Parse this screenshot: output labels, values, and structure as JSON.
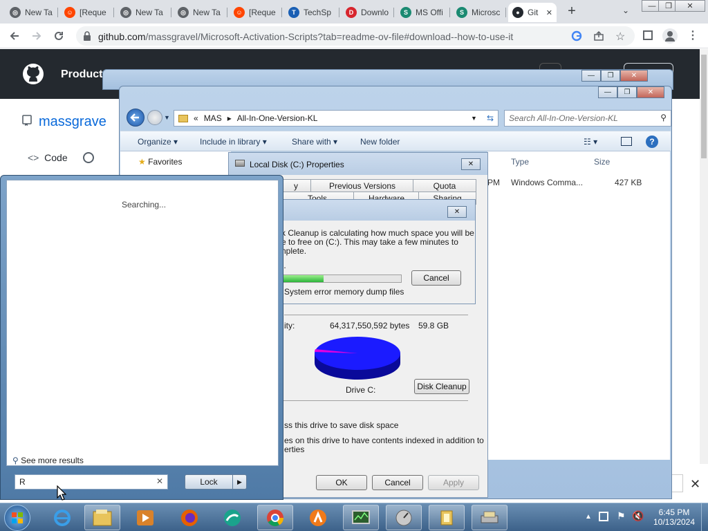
{
  "browser": {
    "tabs": [
      {
        "label": "New Ta",
        "icon": "chrome-icon"
      },
      {
        "label": "[Reque",
        "icon": "reddit-icon"
      },
      {
        "label": "New Ta",
        "icon": "chrome-icon"
      },
      {
        "label": "New Ta",
        "icon": "chrome-icon"
      },
      {
        "label": "[Reque",
        "icon": "reddit-icon"
      },
      {
        "label": "TechSp",
        "icon": "techspot-icon"
      },
      {
        "label": "Downlo",
        "icon": "download-site-icon"
      },
      {
        "label": "MS Offi",
        "icon": "ms-office-icon"
      },
      {
        "label": "Microsc",
        "icon": "ms-office-icon"
      },
      {
        "label": "Git",
        "icon": "github-icon"
      }
    ],
    "url_host": "github.com",
    "url_path": "/massgravel/Microsoft-Activation-Scripts?tab=readme-ov-file#download--how-to-use-it"
  },
  "github": {
    "product_label": "Product",
    "signup_label": "up",
    "repo_owner": "massgrave",
    "code_tab": "Code"
  },
  "explorer": {
    "breadcrumb": [
      "MAS",
      "All-In-One-Version-KL"
    ],
    "search_placeholder": "Search All-In-One-Version-KL",
    "commands": {
      "organize": "Organize",
      "include": "Include in library",
      "share": "Share with",
      "new_folder": "New folder"
    },
    "favorites": "Favorites",
    "columns": {
      "type": "Type",
      "size": "Size"
    },
    "row": {
      "modified_tail": "PM",
      "type": "Windows Comma...",
      "size": "427 KB"
    }
  },
  "properties": {
    "title": "Local Disk (C:) Properties",
    "tabs_row1": [
      "y",
      "Previous Versions",
      "Quota"
    ],
    "tabs_row2": [
      "Tools",
      "Hardware",
      "Sharing"
    ],
    "capacity_label": "ity:",
    "capacity_bytes": "64,317,550,592 bytes",
    "capacity_gb": "59.8 GB",
    "drive_label": "Drive C:",
    "disk_cleanup": "Disk Cleanup",
    "compress": "ss this drive to save disk space",
    "index_line1": "es on this drive to have contents indexed in addition to",
    "index_line2": "erties",
    "ok": "OK",
    "cancel": "Cancel",
    "apply": "Apply"
  },
  "cleanup": {
    "title": "p",
    "line1": "k Cleanup is calculating how much space you will be",
    "line2": "e to free on  (C:). This may take a few minutes to",
    "line3": "nplete.",
    "status_dots": "..",
    "cancel": "Cancel",
    "current_item": "System error memory dump files",
    "progress": 0.34
  },
  "startmenu": {
    "searching": "Searching...",
    "see_more": "See more results",
    "search_value": "R",
    "lock_label": "Lock"
  },
  "clock": {
    "time": "6:45 PM",
    "date": "10/13/2024"
  },
  "colors": {
    "chrome_strip": "#dee1e6",
    "github_header": "#24292f",
    "github_link": "#0969da",
    "progress_green": "#2bb43a",
    "used_space": "#e000e0",
    "free_space": "#1b1bff"
  }
}
